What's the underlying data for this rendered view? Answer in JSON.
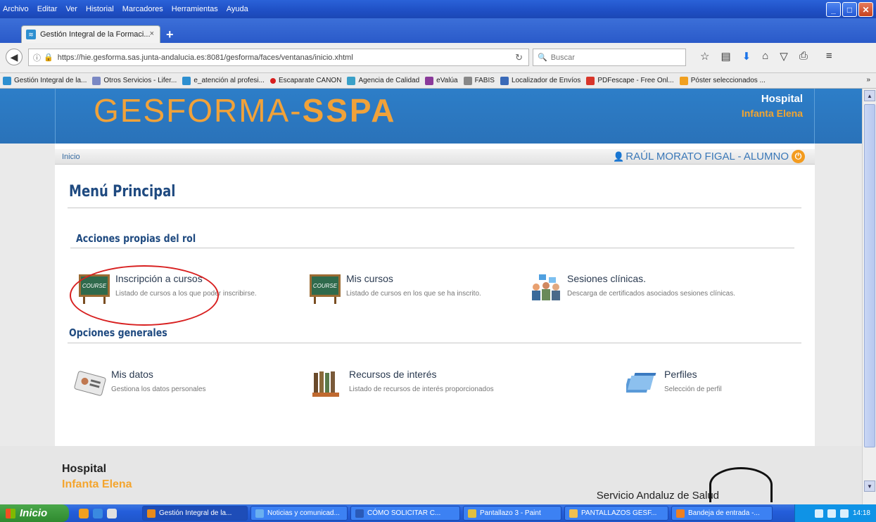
{
  "menubar": {
    "items": [
      "Archivo",
      "Editar",
      "Ver",
      "Historial",
      "Marcadores",
      "Herramientas",
      "Ayuda"
    ]
  },
  "tab": {
    "title": "Gestión Integral de la Formaci...",
    "close": "×",
    "new_tab": "+"
  },
  "nav": {
    "url": "https://hie.gesforma.sas.junta-andalucia.es:8081/gesforma/faces/ventanas/inicio.xhtml",
    "search_placeholder": "Buscar"
  },
  "bookmarks": [
    {
      "label": "Gestión Integral de la...",
      "color": "#2d8fd0"
    },
    {
      "label": "Otros Servicios - Lifer...",
      "color": "#7a88c4"
    },
    {
      "label": "e_atención al profesi...",
      "color": "#2d8fd0"
    },
    {
      "label": "Escaparate CANON",
      "color": "#d81e1e"
    },
    {
      "label": "Agencia de Calidad",
      "color": "#3aa0c8"
    },
    {
      "label": "eValúa",
      "color": "#8a3a9a"
    },
    {
      "label": "FABIS",
      "color": "#888888"
    },
    {
      "label": "Localizador de Envíos",
      "color": "#3a6ab8"
    },
    {
      "label": "PDFescape - Free Onl...",
      "color": "#d8352a"
    },
    {
      "label": "Póster seleccionados ...",
      "color": "#f0a020"
    }
  ],
  "header": {
    "logo_main": "GESFORMA-",
    "logo_bold": "SSPA",
    "hospital_line1": "Hospital",
    "hospital_line2": "Infanta Elena"
  },
  "crumb": "Inicio",
  "user": "RAÚL MORATO FIGAL - ALUMNO",
  "main": {
    "title": "Menú Principal",
    "section1": "Acciones propias del rol",
    "section2": "Opciones generales",
    "items": [
      {
        "title": "Inscripción a cursos",
        "desc": "Listado de cursos a los que poder inscribirse."
      },
      {
        "title": "Mis cursos",
        "desc": "Listado de cursos en los que se ha inscrito."
      },
      {
        "title": "Sesiones clínicas.",
        "desc": "Descarga de certificados asociados sesiones clínicas."
      },
      {
        "title": "Mis datos",
        "desc": "Gestiona los datos personales"
      },
      {
        "title": "Recursos de interés",
        "desc": "Listado de recursos de interés proporcionados"
      },
      {
        "title": "Perfiles",
        "desc": "Selección de perfil"
      }
    ],
    "course_label": "COURSE"
  },
  "footer": {
    "hospital_line1": "Hospital",
    "hospital_line2": "Infanta Elena",
    "sas": "Servicio Andaluz de Salud"
  },
  "taskbar": {
    "start": "Inicio",
    "tasks": [
      "Gestión Integral de la...",
      "Noticias y comunicad...",
      "CÓMO SOLICITAR C...",
      "Pantallazo 3 - Paint",
      "PANTALLAZOS GESF...",
      "Bandeja de entrada -..."
    ],
    "clock": "14:18"
  }
}
